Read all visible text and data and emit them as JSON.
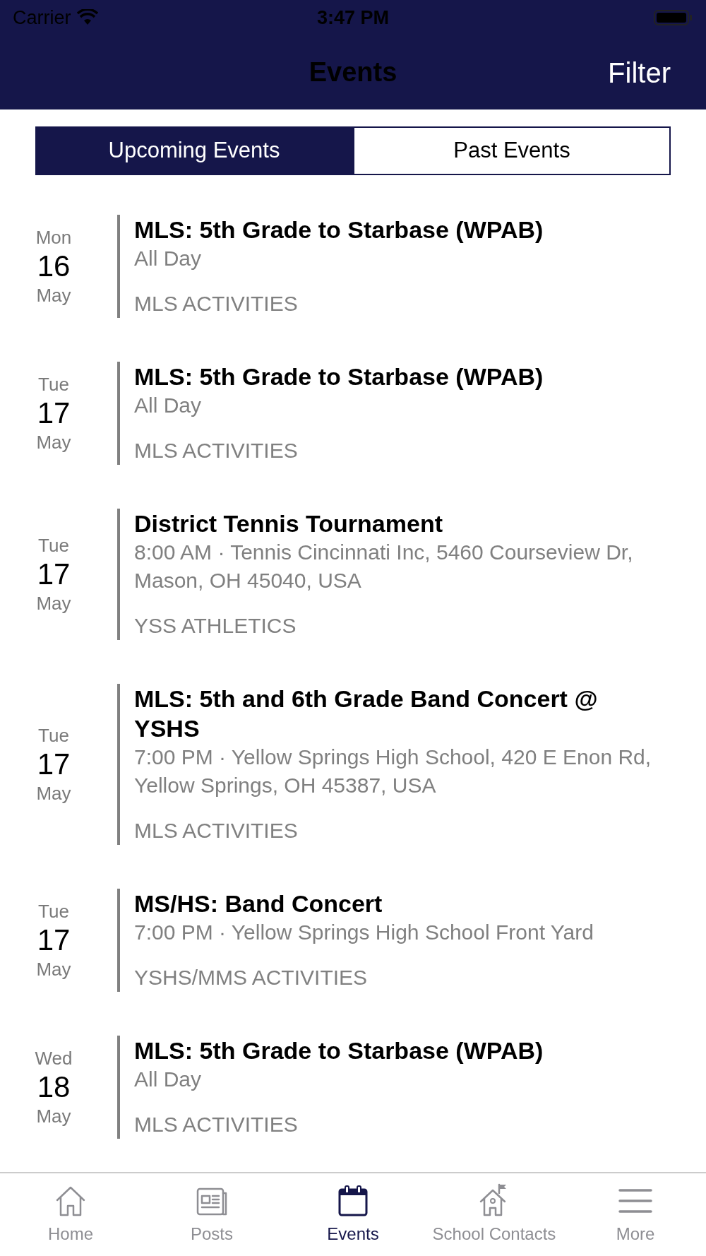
{
  "status_bar": {
    "carrier": "Carrier",
    "time": "3:47 PM"
  },
  "nav": {
    "title": "Events",
    "action": "Filter"
  },
  "segments": [
    {
      "label": "Upcoming Events",
      "selected": true
    },
    {
      "label": "Past Events",
      "selected": false
    }
  ],
  "events": [
    {
      "weekday": "Mon",
      "day": "16",
      "month": "May",
      "title": "MLS: 5th Grade to Starbase (WPAB)",
      "when": "All Day",
      "category": "MLS ACTIVITIES"
    },
    {
      "weekday": "Tue",
      "day": "17",
      "month": "May",
      "title": "MLS: 5th Grade to Starbase (WPAB)",
      "when": "All Day",
      "category": "MLS ACTIVITIES"
    },
    {
      "weekday": "Tue",
      "day": "17",
      "month": "May",
      "title": "District Tennis Tournament",
      "when": "8:00 AM · Tennis Cincinnati Inc, 5460 Courseview Dr, Mason, OH 45040, USA",
      "category": "YSS ATHLETICS"
    },
    {
      "weekday": "Tue",
      "day": "17",
      "month": "May",
      "title": "MLS: 5th and 6th Grade Band Concert @ YSHS",
      "when": "7:00 PM · Yellow Springs High School, 420 E Enon Rd, Yellow Springs, OH 45387, USA",
      "category": "MLS ACTIVITIES"
    },
    {
      "weekday": "Tue",
      "day": "17",
      "month": "May",
      "title": "MS/HS: Band Concert",
      "when": "7:00 PM · Yellow Springs High School Front Yard",
      "category": "YSHS/MMS ACTIVITIES"
    },
    {
      "weekday": "Wed",
      "day": "18",
      "month": "May",
      "title": "MLS: 5th Grade to Starbase (WPAB)",
      "when": "All Day",
      "category": "MLS ACTIVITIES"
    }
  ],
  "tab_bar": [
    {
      "label": "Home",
      "kind": "home",
      "selected": false
    },
    {
      "label": "Posts",
      "kind": "posts",
      "selected": false
    },
    {
      "label": "Events",
      "kind": "calendar",
      "selected": true
    },
    {
      "label": "School Contacts",
      "kind": "school",
      "selected": false
    },
    {
      "label": "More",
      "kind": "menu",
      "selected": false
    }
  ]
}
